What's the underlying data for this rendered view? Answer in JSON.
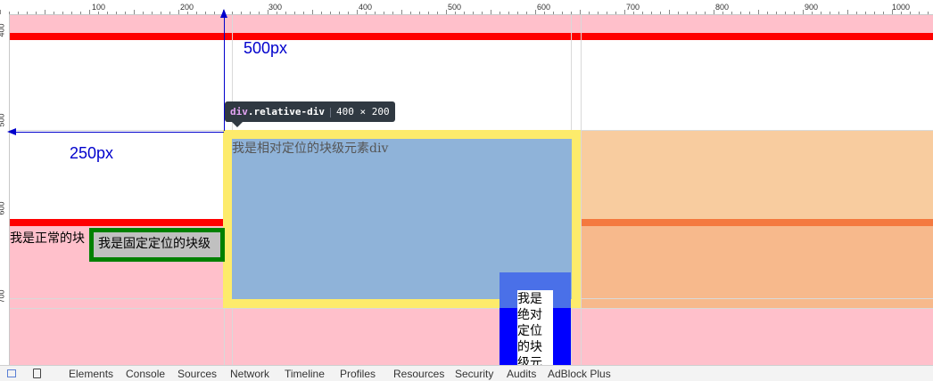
{
  "ruler": {
    "top_ticks": [
      "100",
      "200",
      "300",
      "400",
      "500",
      "600",
      "700",
      "800",
      "900",
      "1000"
    ],
    "left_ticks": [
      "400",
      "500",
      "600",
      "700"
    ]
  },
  "content": {
    "normal_block_text": "我是正常的块",
    "fixed_block_text": "我是固定定位的块级",
    "relative_block_text": "我是相对定位的块级元素div",
    "absolute_block_text": "我是绝对定位的块级元"
  },
  "measurements": {
    "top_offset": "500px",
    "left_offset": "250px"
  },
  "tooltip": {
    "tag": "div",
    "class": ".relative-div",
    "size": "400 × 200"
  },
  "devtools_tabs": [
    "Elements",
    "Console",
    "Sources",
    "Network",
    "Timeline",
    "Profiles",
    "Resources",
    "Security",
    "Audits",
    "AdBlock Plus"
  ],
  "colors": {
    "highlight_content": "#8fb3d9",
    "highlight_border": "#fdeb6b",
    "highlight_margin": "#f8cc9f",
    "fixed_border": "#008000",
    "absolute_bg": "#0000ff",
    "measure_color": "#0000cc",
    "red_bar": "#ff0000",
    "page_pink": "#ffc0cb"
  },
  "icons": [
    "inspect-element-icon",
    "device-mode-icon"
  ]
}
